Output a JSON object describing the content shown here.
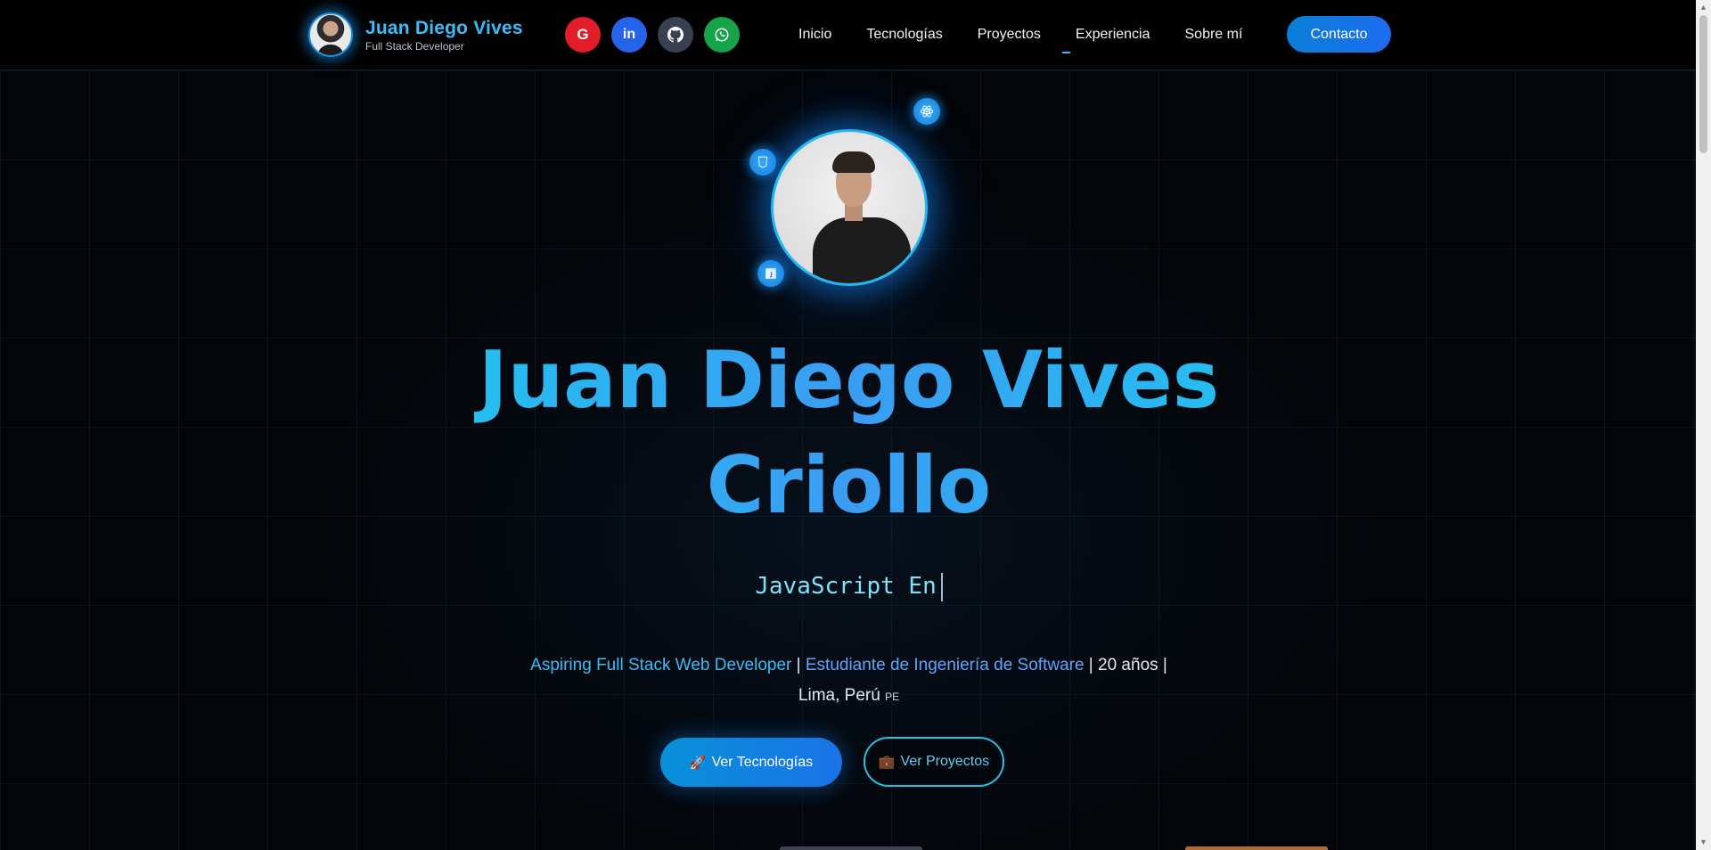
{
  "header": {
    "brand_name": "Juan Diego Vives",
    "brand_role": "Full Stack Developer",
    "socials": [
      {
        "name": "google",
        "glyph": "G",
        "color": "#e11d2a"
      },
      {
        "name": "linkedin",
        "glyph": "in",
        "color": "#2563eb"
      },
      {
        "name": "github",
        "glyph": "◕",
        "color": "#374151"
      },
      {
        "name": "whatsapp",
        "glyph": "✆",
        "color": "#16a34a"
      }
    ],
    "nav": [
      "Inicio",
      "Tecnologías",
      "Proyectos",
      "Experiencia",
      "Sobre mí"
    ],
    "active_nav": "Experiencia",
    "contact_label": "Contacto"
  },
  "hero": {
    "orbit_icons": [
      "react-icon",
      "css-icon",
      "js-icon"
    ],
    "name_line1": "Juan Diego Vives",
    "name_line2": "Criollo",
    "typed_text": "JavaScript En",
    "tagline": {
      "part1": "Aspiring Full Stack Web Developer",
      "sep1": " | ",
      "part2": "Estudiante de Ingeniería de Software",
      "sep2": " | 20 años | ",
      "location": "Lima, Perú",
      "flag": "PE"
    },
    "primary_button": {
      "icon": "🚀",
      "label": "Ver Tecnologías"
    },
    "secondary_button": {
      "icon": "💼",
      "label": "Ver Proyectos"
    }
  },
  "colors": {
    "accent": "#38bdf8",
    "primary_blue": "#1a72e8",
    "background": "#030508"
  }
}
